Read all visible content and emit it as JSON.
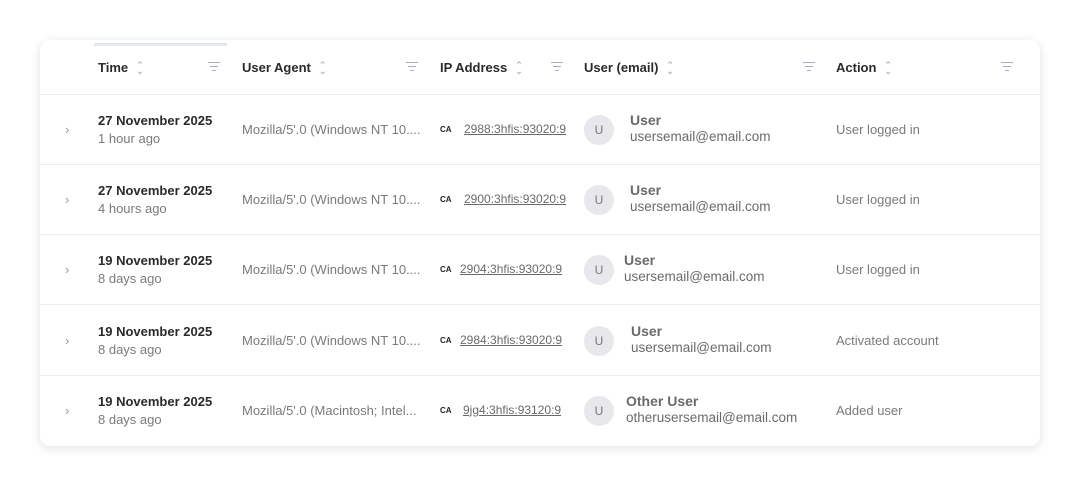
{
  "columns": [
    "Time",
    "User Agent",
    "IP Address",
    "User (email)",
    "Action"
  ],
  "rows": [
    {
      "date": "27 November 2025",
      "relative": "1 hour ago",
      "agent": "Mozilla/5'.0 (Windows NT 10....",
      "country": "CA",
      "ip": "2988:3hfis:93020:9",
      "avatar": "U",
      "name": "User",
      "email": "usersemail@email.com",
      "action": "User logged in"
    },
    {
      "date": "27 November 2025",
      "relative": "4 hours ago",
      "agent": "Mozilla/5'.0 (Windows NT 10....",
      "country": "CA",
      "ip": "2900:3hfis:93020:9",
      "avatar": "U",
      "name": "User",
      "email": "usersemail@email.com",
      "action": "User logged in"
    },
    {
      "date": "19 November 2025",
      "relative": "8 days ago",
      "agent": "Mozilla/5'.0 (Windows NT 10....",
      "country": "CA",
      "ip": "2904:3hfis:93020:9",
      "avatar": "U",
      "name": "User",
      "email": "usersemail@email.com",
      "action": "User logged in"
    },
    {
      "date": "19 November 2025",
      "relative": "8 days ago",
      "agent": "Mozilla/5'.0 (Windows NT 10....",
      "country": "CA",
      "ip": "2984:3hfis:93020:9",
      "avatar": "U",
      "name": "User",
      "email": "usersemail@email.com",
      "action": "Activated account"
    },
    {
      "date": "19 November 2025",
      "relative": "8 days ago",
      "agent": "Mozilla/5'.0 (Macintosh; Intel...",
      "country": "CA",
      "ip": "9jg4:3hfis:93120:9",
      "avatar": "U",
      "name": "Other User",
      "email": "otherusersemail@email.com",
      "action": "Added user"
    }
  ]
}
